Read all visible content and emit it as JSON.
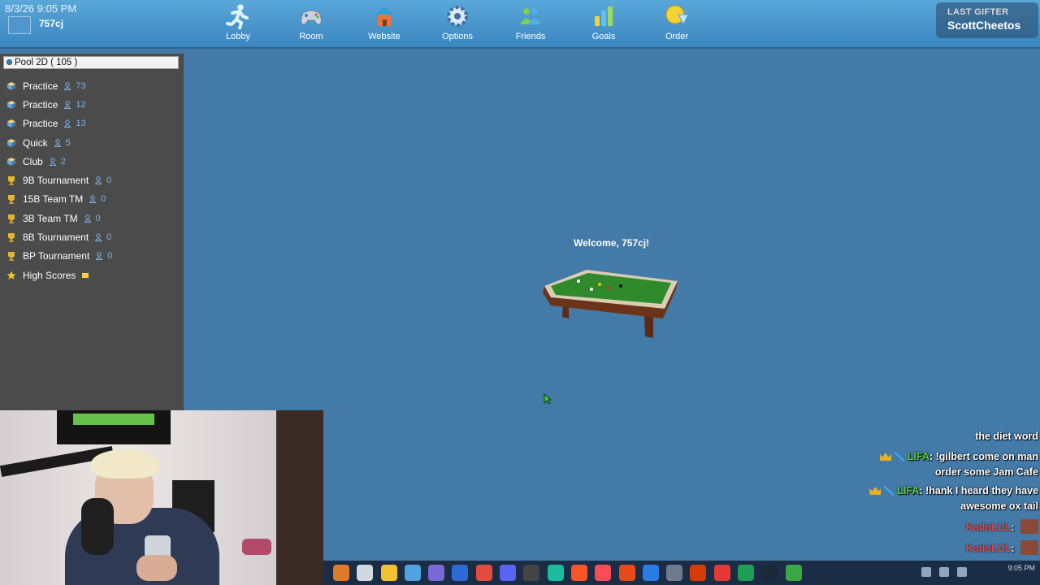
{
  "header": {
    "timestamp": "8/3/26 9:05 PM",
    "username": "757cj",
    "nav": [
      {
        "label": "Lobby",
        "icon": "running-man-icon"
      },
      {
        "label": "Room",
        "icon": "gamepad-icon"
      },
      {
        "label": "Website",
        "icon": "house-icon"
      },
      {
        "label": "Options",
        "icon": "gear-icon"
      },
      {
        "label": "Friends",
        "icon": "people-icon"
      },
      {
        "label": "Goals",
        "icon": "bar-chart-icon"
      },
      {
        "label": "Order",
        "icon": "coin-icon"
      }
    ],
    "gifter": {
      "label": "LAST GIFTER",
      "name": "ScottCheetos"
    }
  },
  "sidebar": {
    "header": "Pool 2D  ( 105 )",
    "rooms": [
      {
        "name": "Practice",
        "count": "73",
        "icon": "cube-icon"
      },
      {
        "name": "Practice",
        "count": "12",
        "icon": "cube-icon"
      },
      {
        "name": "Practice",
        "count": "13",
        "icon": "cube-icon"
      },
      {
        "name": "Quick",
        "count": "5",
        "icon": "cube-icon"
      },
      {
        "name": "Club",
        "count": "2",
        "icon": "cube-icon"
      },
      {
        "name": "9B Tournament",
        "count": "0",
        "icon": "trophy-icon"
      },
      {
        "name": "15B Team TM",
        "count": "0",
        "icon": "trophy-icon"
      },
      {
        "name": "3B Team TM",
        "count": "0",
        "icon": "trophy-icon"
      },
      {
        "name": "8B Tournament",
        "count": "0",
        "icon": "trophy-icon"
      },
      {
        "name": "BP Tournament",
        "count": "0",
        "icon": "trophy-icon"
      }
    ],
    "high_scores": "High Scores"
  },
  "stage": {
    "welcome": "Welcome, 757cj!",
    "table_colors": {
      "felt": "#2f8a2c",
      "wood": "#6b3418",
      "rail": "#d9cdb4"
    }
  },
  "chat": {
    "lines": [
      {
        "text": "the diet word"
      },
      {
        "author": "LIFA",
        "text": "!gilbert come on man order some Jam Cafe"
      },
      {
        "author": "LIFA",
        "text": "!hank I heard they have awesome ox tail"
      },
      {
        "author": "KadoLUL",
        "text": ""
      },
      {
        "author": "KadoLUL",
        "text": ""
      },
      {
        "author": "KadoLUL",
        "text": ""
      }
    ]
  },
  "taskbar": {
    "time": "9:05 PM",
    "icon_colors": [
      "#e07a2b",
      "#cfd8e3",
      "#f2c230",
      "#4fa3e0",
      "#7b68d6",
      "#2d6ad6",
      "#e54b3c",
      "#5865f2",
      "#444444",
      "#1abc9c",
      "#fb542b",
      "#f94c57",
      "#e64a19",
      "#2a7be4",
      "#6d7b8d",
      "#d83b01",
      "#e53935",
      "#1e9e57",
      "#1b2838",
      "#39a845"
    ]
  }
}
